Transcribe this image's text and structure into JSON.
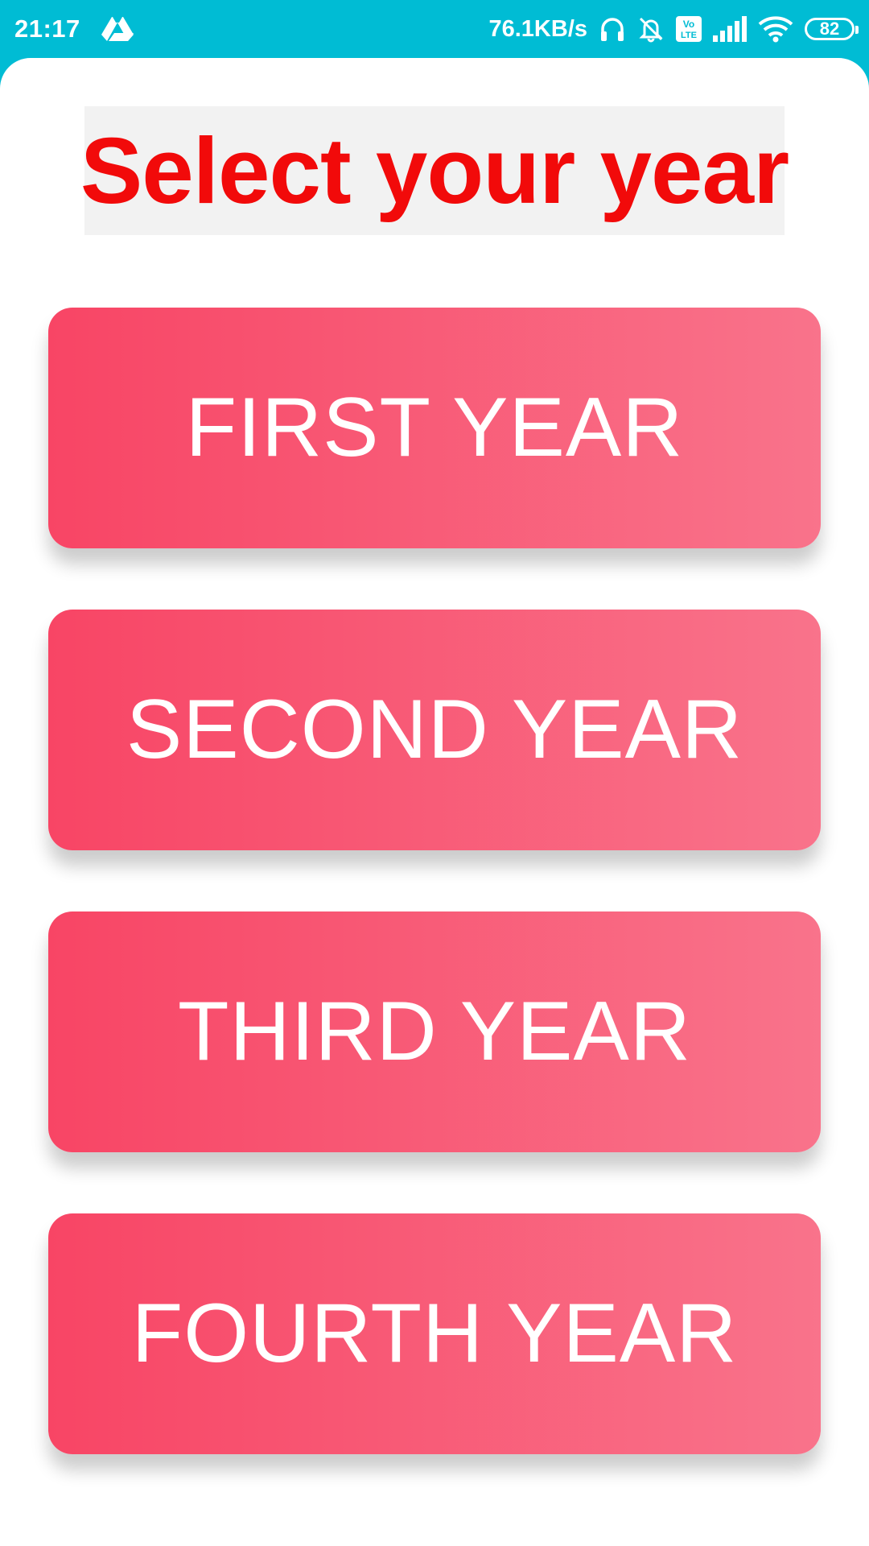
{
  "status_bar": {
    "time": "21:17",
    "network_speed": "76.1KB/s",
    "volte_label_top": "Vo",
    "volte_label_bottom": "LTE",
    "battery_level": "82",
    "icons": [
      "drive-icon",
      "headphones-icon",
      "bell-muted-icon",
      "volte-icon",
      "signal-icon",
      "wifi-icon",
      "battery-icon"
    ]
  },
  "page": {
    "title": "Select your year",
    "title_color": "#f20a0a"
  },
  "year_buttons": [
    {
      "label": "FIRST YEAR"
    },
    {
      "label": "SECOND YEAR"
    },
    {
      "label": "THIRD YEAR"
    },
    {
      "label": "FOURTH YEAR"
    }
  ],
  "colors": {
    "status_bar": "#00bcd4",
    "button_gradient_start": "#f84565",
    "button_gradient_end": "#f9738b",
    "button_text": "#ffffff"
  }
}
